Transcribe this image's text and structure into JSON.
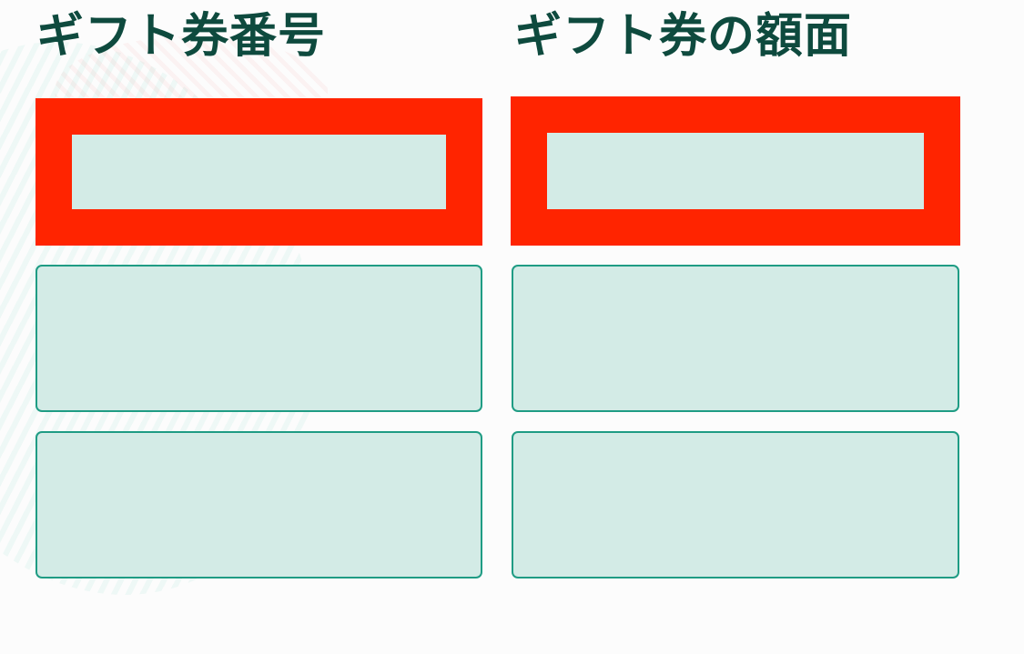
{
  "columns": {
    "left": {
      "title": "ギフト券番号",
      "rows": [
        {
          "value": "",
          "highlighted": true
        },
        {
          "value": "",
          "highlighted": false
        },
        {
          "value": "",
          "highlighted": false
        }
      ]
    },
    "right": {
      "title": "ギフト券の額面",
      "rows": [
        {
          "value": "",
          "highlighted": true
        },
        {
          "value": "",
          "highlighted": false
        },
        {
          "value": "",
          "highlighted": false
        }
      ]
    }
  },
  "colors": {
    "title_text": "#0e4a3e",
    "highlight_frame": "#ff2400",
    "field_fill": "#d3ebe6",
    "field_border": "#1f9c84",
    "background": "#fcfcfc"
  }
}
